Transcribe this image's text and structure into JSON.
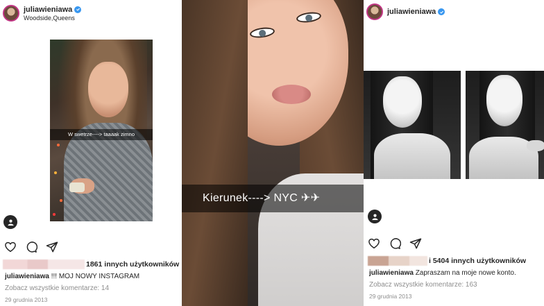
{
  "left_post": {
    "username": "juliawieniawa",
    "location": "Woodside,Queens",
    "photo_caption": "W swetrze----> taaaak zimno",
    "likes_text": "1861 innych użytkowników",
    "caption_user": "juliawieniawa",
    "caption_text": " !!! MOJ NOWY INSTAGRAM",
    "comments_link": "Zobacz wszystkie komentarze: 14",
    "date": "29 grudnia 2013"
  },
  "middle_post": {
    "photo_caption": "Kierunek----> NYC ✈✈"
  },
  "right_post": {
    "username": "juliawieniawa",
    "likes_text": "i 5404 innych użytkowników",
    "caption_user": "juliawieniawa",
    "caption_text": " Zapraszam na moje nowe konto.",
    "comments_link": "Zobacz wszystkie komentarze: 163",
    "date": "29 grudnia 2013"
  },
  "icons": {
    "verified": "verified-badge-icon",
    "tag": "user-tag-icon",
    "like": "heart-icon",
    "comment": "comment-icon",
    "share": "send-icon"
  },
  "colors": {
    "verified": "#3897f0",
    "text": "#262626",
    "muted": "#8e8e8e"
  }
}
